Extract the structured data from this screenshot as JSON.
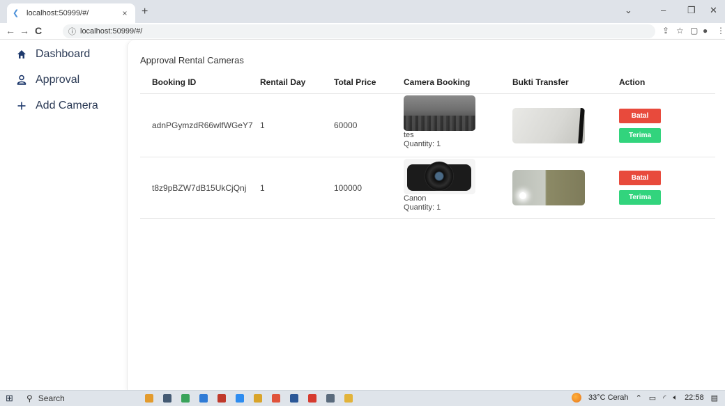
{
  "browser": {
    "tab_title": "localhost:50999/#/",
    "tab_close": "×",
    "new_tab": "+",
    "url": "localhost:50999/#/",
    "window_controls": [
      "⌄",
      "–",
      "❐",
      "✕"
    ]
  },
  "sidebar": {
    "items": [
      {
        "label": "Dashboard",
        "icon": "home-icon"
      },
      {
        "label": "Approval",
        "icon": "person-icon"
      },
      {
        "label": "Add Camera",
        "icon": "plus-icon"
      }
    ]
  },
  "main": {
    "title": "Approval Rental Cameras",
    "columns": [
      "Booking ID",
      "Rentail Day",
      "Total Price",
      "Camera Booking",
      "Bukti Transfer",
      "Action"
    ],
    "rows": [
      {
        "booking_id": "adnPGymzdR66wlfWGeY7",
        "rental_day": "1",
        "total_price": "60000",
        "camera_name": "tes",
        "quantity": "Quantity: 1",
        "batal": "Batal",
        "terima": "Terima"
      },
      {
        "booking_id": "t8z9pBZW7dB15UkCjQnj",
        "rental_day": "1",
        "total_price": "100000",
        "camera_name": "Canon",
        "quantity": "Quantity: 1",
        "batal": "Batal",
        "terima": "Terima"
      }
    ]
  },
  "taskbar": {
    "search_label": "Search",
    "weather": "33°C Cerah",
    "time": "22:58"
  },
  "colors": {
    "batal": "#e84a3c",
    "terima": "#32d47d",
    "nav_icon": "#1f3a6d"
  }
}
